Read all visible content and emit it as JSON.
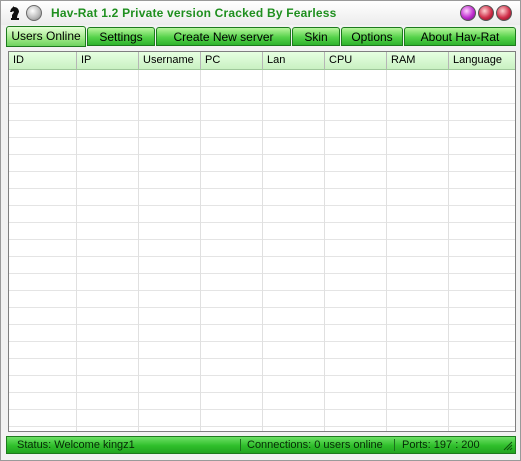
{
  "window": {
    "title": "Hav-Rat 1.2 Private version Cracked By Fearless",
    "accent": "#1f8f1f"
  },
  "tabs": [
    {
      "label": "Users Online",
      "active": true
    },
    {
      "label": "Settings"
    },
    {
      "label": "Create New server"
    },
    {
      "label": "Skin"
    },
    {
      "label": "Options"
    },
    {
      "label": "About Hav-Rat"
    }
  ],
  "table": {
    "columns": [
      "ID",
      "IP",
      "Username",
      "PC",
      "Lan",
      "CPU",
      "RAM",
      "Language"
    ],
    "rows": []
  },
  "status": {
    "message": "Status: Welcome kingz1",
    "connections": "Connections: 0 users online",
    "ports": "Ports: 197 : 200"
  },
  "icons": {
    "app": "chess-knight-icon",
    "left_button": "round-gray-button-icon",
    "minimize": "purple-round-button-icon",
    "maximize": "red-round-button-icon",
    "close": "red-round-button-icon"
  }
}
